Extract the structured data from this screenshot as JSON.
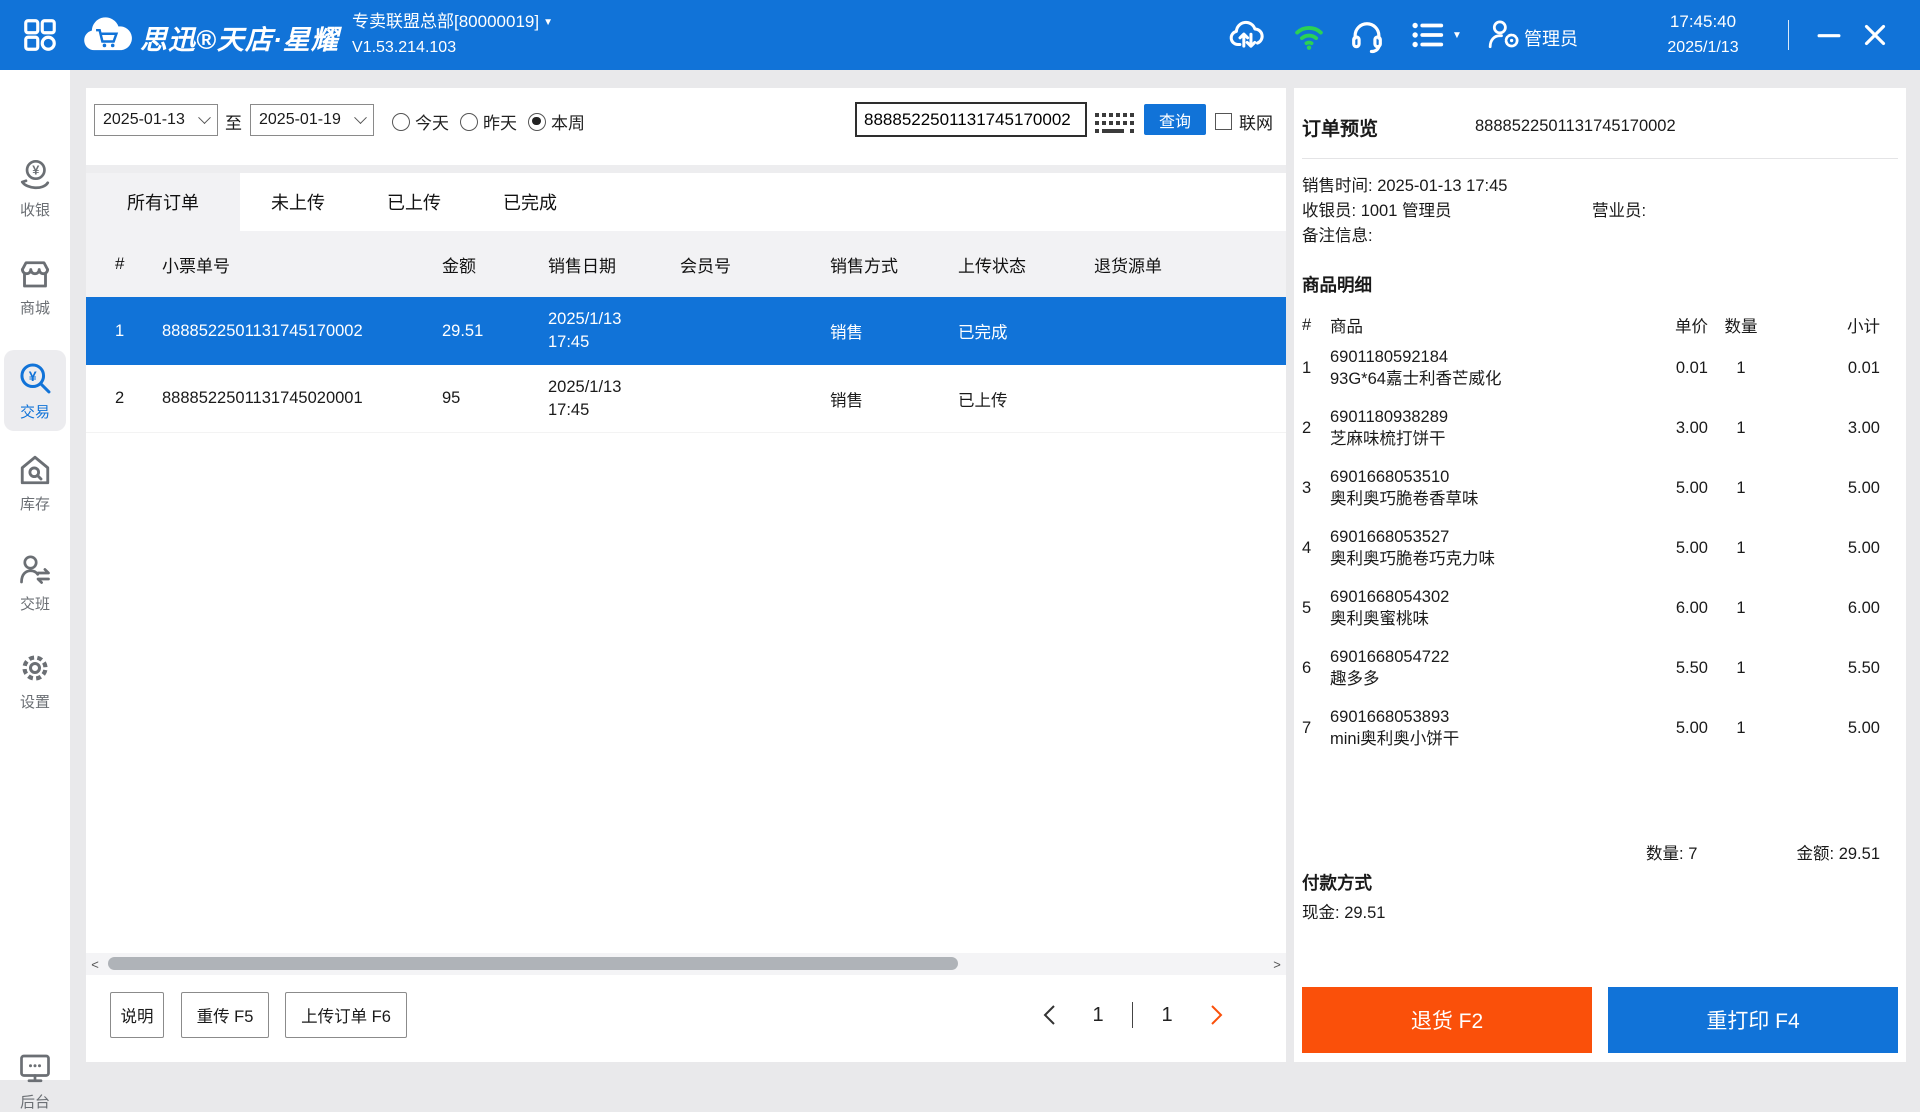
{
  "colors": {
    "accent_blue": "#1173D8",
    "accent_orange": "#FA500A",
    "wifi_green": "#2BD155",
    "selected_row": "#1173D8"
  },
  "topbar": {
    "brand": "思迅®天店·星耀",
    "store_name": "专卖联盟总部[80000019]",
    "store_caret": "▼",
    "version": "V1.53.214.103",
    "menu_caret": "▼",
    "user": "管理员",
    "time": "17:45:40",
    "date": "2025/1/13"
  },
  "sidebar": {
    "items": [
      {
        "label": "收银"
      },
      {
        "label": "商城"
      },
      {
        "label": "交易",
        "active": true
      },
      {
        "label": "库存"
      },
      {
        "label": "交班"
      },
      {
        "label": "设置"
      }
    ],
    "bottom": {
      "label": "后台"
    }
  },
  "filters": {
    "date_from": "2025-01-13",
    "to_label": "至",
    "date_to": "2025-01-19",
    "radios": [
      {
        "label": "今天",
        "checked": false
      },
      {
        "label": "昨天",
        "checked": false
      },
      {
        "label": "本周",
        "checked": true
      }
    ],
    "search_value": "8888522501131745170002",
    "query_label": "查询",
    "online_label": "联网",
    "online_checked": false
  },
  "tabs": [
    {
      "label": "所有订单",
      "active": true
    },
    {
      "label": "未上传",
      "active": false
    },
    {
      "label": "已上传",
      "active": false
    },
    {
      "label": "已完成",
      "active": false
    }
  ],
  "orders_table": {
    "headers": [
      "#",
      "小票单号",
      "金额",
      "销售日期",
      "会员号",
      "销售方式",
      "上传状态",
      "退货源单"
    ],
    "rows": [
      {
        "index": "1",
        "receipt_no": "8888522501131745170002",
        "amount": "29.51",
        "date_line1": "2025/1/13",
        "date_line2": "17:45",
        "member": "",
        "method": "销售",
        "status": "已完成",
        "return_source": "",
        "selected": true
      },
      {
        "index": "2",
        "receipt_no": "8888522501131745020001",
        "amount": "95",
        "date_line1": "2025/1/13",
        "date_line2": "17:45",
        "member": "",
        "method": "销售",
        "status": "已上传",
        "return_source": "",
        "selected": false
      }
    ]
  },
  "footer": {
    "buttons": [
      {
        "label": "说明"
      },
      {
        "label": "重传 F5"
      },
      {
        "label": "上传订单 F6"
      }
    ],
    "pagination": {
      "current": "1",
      "total": "1"
    }
  },
  "preview": {
    "title": "订单预览",
    "order_no": "8888522501131745170002",
    "sale_time_label": "销售时间:",
    "sale_time": "2025-01-13 17:45",
    "cashier_label": "收银员:",
    "cashier": "1001 管理员",
    "clerk_label": "营业员:",
    "clerk": "",
    "remark_label": "备注信息:",
    "remark": "",
    "detail_title": "商品明细",
    "items_headers": [
      "#",
      "商品",
      "单价",
      "数量",
      "小计"
    ],
    "items": [
      {
        "n": "1",
        "code": "6901180592184",
        "name": "93G*64嘉士利香芒威化",
        "price": "0.01",
        "qty": "1",
        "subtotal": "0.01"
      },
      {
        "n": "2",
        "code": "6901180938289",
        "name": "芝麻味梳打饼干",
        "price": "3.00",
        "qty": "1",
        "subtotal": "3.00"
      },
      {
        "n": "3",
        "code": "6901668053510",
        "name": "奥利奥巧脆卷香草味",
        "price": "5.00",
        "qty": "1",
        "subtotal": "5.00"
      },
      {
        "n": "4",
        "code": "6901668053527",
        "name": "奥利奥巧脆卷巧克力味",
        "price": "5.00",
        "qty": "1",
        "subtotal": "5.00"
      },
      {
        "n": "5",
        "code": "6901668054302",
        "name": "奥利奥蜜桃味",
        "price": "6.00",
        "qty": "1",
        "subtotal": "6.00"
      },
      {
        "n": "6",
        "code": "6901668054722",
        "name": "趣多多",
        "price": "5.50",
        "qty": "1",
        "subtotal": "5.50"
      },
      {
        "n": "7",
        "code": "6901668053893",
        "name": "mini奥利奥小饼干",
        "price": "5.00",
        "qty": "1",
        "subtotal": "5.00"
      }
    ],
    "totals": {
      "qty_label": "数量:",
      "qty": "7",
      "amount_label": "金额:",
      "amount": "29.51"
    },
    "payment_title": "付款方式",
    "payment": {
      "label": "现金:",
      "value": "29.51"
    },
    "return_button": "退货 F2",
    "reprint_button": "重打印 F4"
  }
}
